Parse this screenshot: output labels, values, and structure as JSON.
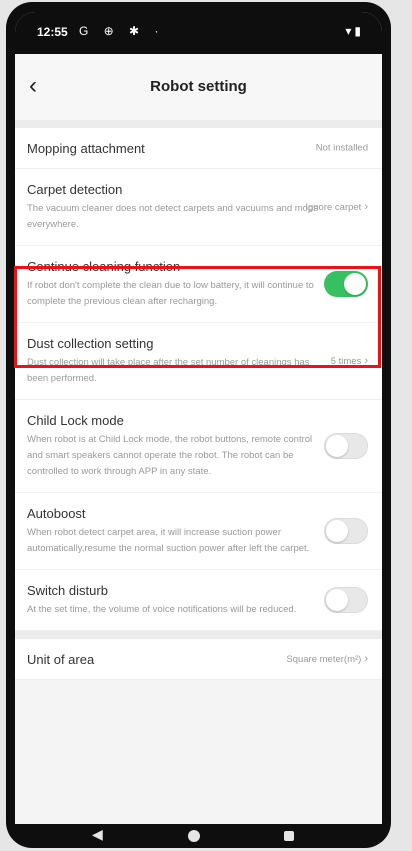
{
  "status_bar": {
    "time": "12:55",
    "icons": "G ⊕ ✱ ·",
    "right": "▾▮"
  },
  "header": {
    "title": "Robot setting"
  },
  "rows": [
    {
      "title": "Mopping attachment",
      "value": "Not installed"
    },
    {
      "title": "Carpet detection",
      "desc": "The vacuum cleaner does not detect carpets and vacuums and mops everywhere.",
      "value": "Ignore carpet"
    },
    {
      "title": "Continue cleaning function",
      "desc": "If robot don't complete the clean due to low battery, it will continue to complete the previous clean after recharging.",
      "toggle": true
    },
    {
      "title": "Dust collection setting",
      "desc": "Dust collection will take place after the set number of cleanings has been performed.",
      "value": "5 times"
    },
    {
      "title": "Child Lock mode",
      "desc": "When robot is at Child Lock mode, the robot buttons, remote control and smart speakers cannot operate the robot. The robot can be controlled to work through APP in any state.",
      "toggle": false
    },
    {
      "title": "Autoboost",
      "desc": "When robot detect carpet area, it will increase suction power automatically,resume the normal suction power after left the carpet.",
      "toggle": false
    },
    {
      "title": "Switch disturb",
      "desc": "At the set time, the volume of voice notifications will be reduced.",
      "toggle": false
    },
    {
      "title": "Unit of area",
      "value": "Square meter(m²)"
    }
  ],
  "chevron": "›",
  "nav": {
    "back": "◀"
  },
  "colors": {
    "accent": "#35c15f",
    "highlight": "#ee1111"
  }
}
